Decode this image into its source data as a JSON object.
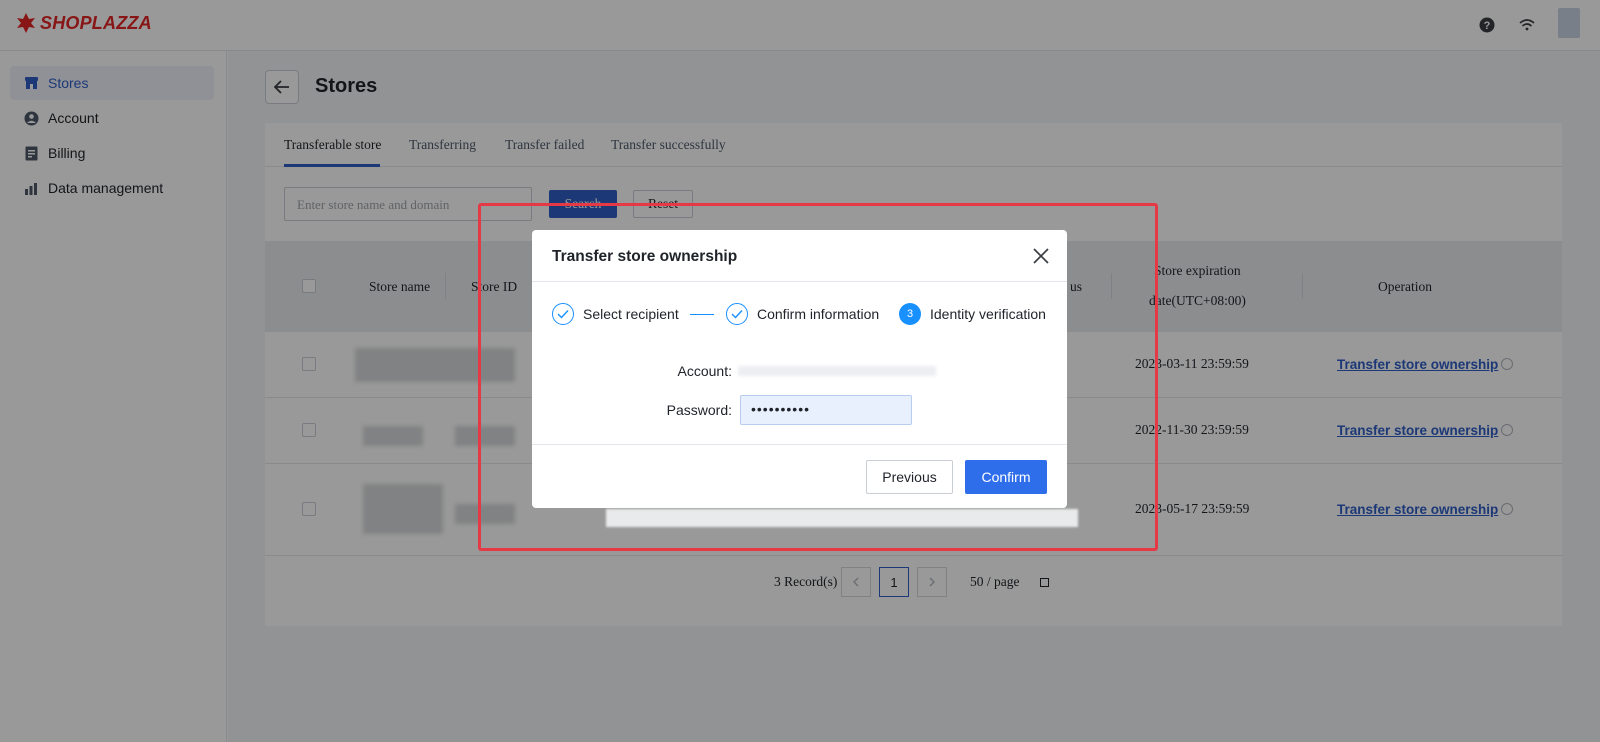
{
  "brand": {
    "name": "SHOPLAZZA",
    "color": "#e32626"
  },
  "topbar": {
    "icons": [
      "help-icon",
      "wifi-icon"
    ]
  },
  "sidebar": {
    "items": [
      {
        "label": "Stores",
        "icon": "store-icon",
        "active": true
      },
      {
        "label": "Account",
        "icon": "user-icon",
        "active": false
      },
      {
        "label": "Billing",
        "icon": "billing-icon",
        "active": false
      },
      {
        "label": "Data management",
        "icon": "chart-icon",
        "active": false
      }
    ]
  },
  "page": {
    "title": "Stores"
  },
  "tabs": [
    {
      "label": "Transferable store",
      "active": true
    },
    {
      "label": "Transferring",
      "active": false
    },
    {
      "label": "Transfer failed",
      "active": false
    },
    {
      "label": "Transfer successfully",
      "active": false
    }
  ],
  "search": {
    "placeholder": "Enter store name and domain",
    "search_label": "Search",
    "reset_label": "Reset"
  },
  "table": {
    "headers": {
      "store_name": "Store name",
      "store_id": "Store ID",
      "status_fragment": "us",
      "expiration_line1": "Store expiration",
      "expiration_line2": "date(UTC+08:00)",
      "operation": "Operation"
    },
    "rows": [
      {
        "expiration": "2023-03-11 23:59:59",
        "operation": "Transfer store ownership"
      },
      {
        "expiration": "2022-11-30 23:59:59",
        "operation": "Transfer store ownership"
      },
      {
        "expiration": "2023-05-17 23:59:59",
        "operation": "Transfer store ownership"
      }
    ]
  },
  "pagination": {
    "records": "3 Record(s)",
    "current_page": "1",
    "page_size": "50 / page"
  },
  "modal": {
    "title": "Transfer store ownership",
    "steps": [
      {
        "label": "Select recipient",
        "state": "done"
      },
      {
        "label": "Confirm information",
        "state": "done"
      },
      {
        "number": "3",
        "label": "Identity verification",
        "state": "current"
      }
    ],
    "account_label": "Account:",
    "password_label": "Password:",
    "password_value": "••••••••••",
    "previous_label": "Previous",
    "confirm_label": "Confirm"
  },
  "colors": {
    "accent": "#2f5ec7",
    "step": "#1890ff",
    "highlight": "#e63946"
  }
}
